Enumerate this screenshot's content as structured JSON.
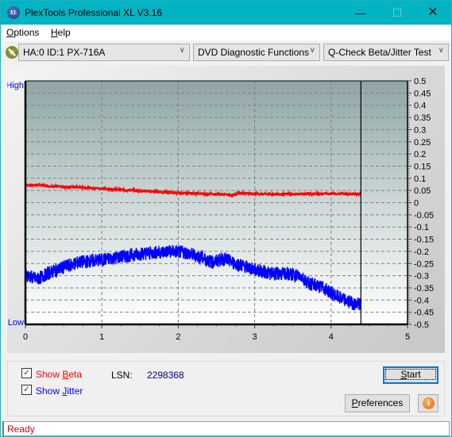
{
  "window": {
    "title": "PlexTools Professional XL V3.16",
    "icon": "xl-logo-icon",
    "icon_text": "XL",
    "controls": {
      "minimize": "—",
      "maximize": "☐",
      "close": "✕"
    }
  },
  "menu": [
    {
      "label": "Options",
      "accel": "O",
      "rest": "ptions"
    },
    {
      "label": "Help",
      "accel": "H",
      "rest": "elp"
    }
  ],
  "toolbar": {
    "drive": "HA:0 ID:1  PX-716A",
    "function": "DVD Diagnostic Functions",
    "test": "Q-Check Beta/Jitter Test"
  },
  "chart_data": {
    "type": "line",
    "title": "",
    "xlabel": "",
    "ylabel": "",
    "left_axis_labels": {
      "top": "High",
      "bottom": "Low"
    },
    "xlim": [
      0,
      5
    ],
    "ylim": [
      -0.5,
      0.5
    ],
    "x_ticks": [
      "0",
      "1",
      "2",
      "3",
      "4",
      "5"
    ],
    "y_ticks": [
      "0.5",
      "0.45",
      "0.4",
      "0.35",
      "0.3",
      "0.25",
      "0.2",
      "0.15",
      "0.1",
      "0.05",
      "0",
      "-0.05",
      "-0.1",
      "-0.15",
      "-0.2",
      "-0.25",
      "-0.3",
      "-0.35",
      "-0.4",
      "-0.45",
      "-0.5"
    ],
    "grid": true,
    "end_marker_x": 4.39,
    "series": [
      {
        "name": "Beta",
        "color": "#ff0000",
        "x": [
          0,
          0.1,
          0.2,
          0.3,
          0.5,
          0.8,
          1.0,
          1.3,
          1.6,
          2.0,
          2.3,
          2.6,
          2.7,
          2.8,
          3.0,
          3.3,
          3.6,
          4.0,
          4.39
        ],
        "y": [
          0.072,
          0.072,
          0.073,
          0.068,
          0.065,
          0.062,
          0.058,
          0.052,
          0.047,
          0.04,
          0.037,
          0.034,
          0.031,
          0.04,
          0.037,
          0.035,
          0.036,
          0.037,
          0.036
        ]
      },
      {
        "name": "Jitter",
        "color": "#0000ff",
        "x": [
          0,
          0.15,
          0.3,
          0.5,
          0.7,
          1.0,
          1.3,
          1.5,
          1.7,
          1.9,
          2.1,
          2.3,
          2.45,
          2.6,
          2.75,
          3.0,
          3.2,
          3.5,
          3.6,
          3.7,
          3.9,
          4.1,
          4.3,
          4.39
        ],
        "y": [
          -0.295,
          -0.315,
          -0.29,
          -0.265,
          -0.245,
          -0.235,
          -0.22,
          -0.21,
          -0.205,
          -0.2,
          -0.205,
          -0.225,
          -0.245,
          -0.23,
          -0.25,
          -0.275,
          -0.29,
          -0.295,
          -0.3,
          -0.33,
          -0.35,
          -0.39,
          -0.415,
          -0.42
        ]
      }
    ]
  },
  "controls": {
    "show_beta": {
      "label_pre": "Show ",
      "accel": "B",
      "label_post": "eta",
      "checked": true,
      "color": "#ff0000"
    },
    "show_jitter": {
      "label_pre": "Show ",
      "accel": "J",
      "label_post": "itter",
      "checked": true,
      "color": "#0000ff"
    },
    "lsn_label": "LSN:",
    "lsn_value": "2298368",
    "start": {
      "accel": "S",
      "rest": "tart"
    },
    "preferences": {
      "accel": "P",
      "rest": "references"
    },
    "info_icon": "i"
  },
  "status": {
    "text": "Ready"
  }
}
